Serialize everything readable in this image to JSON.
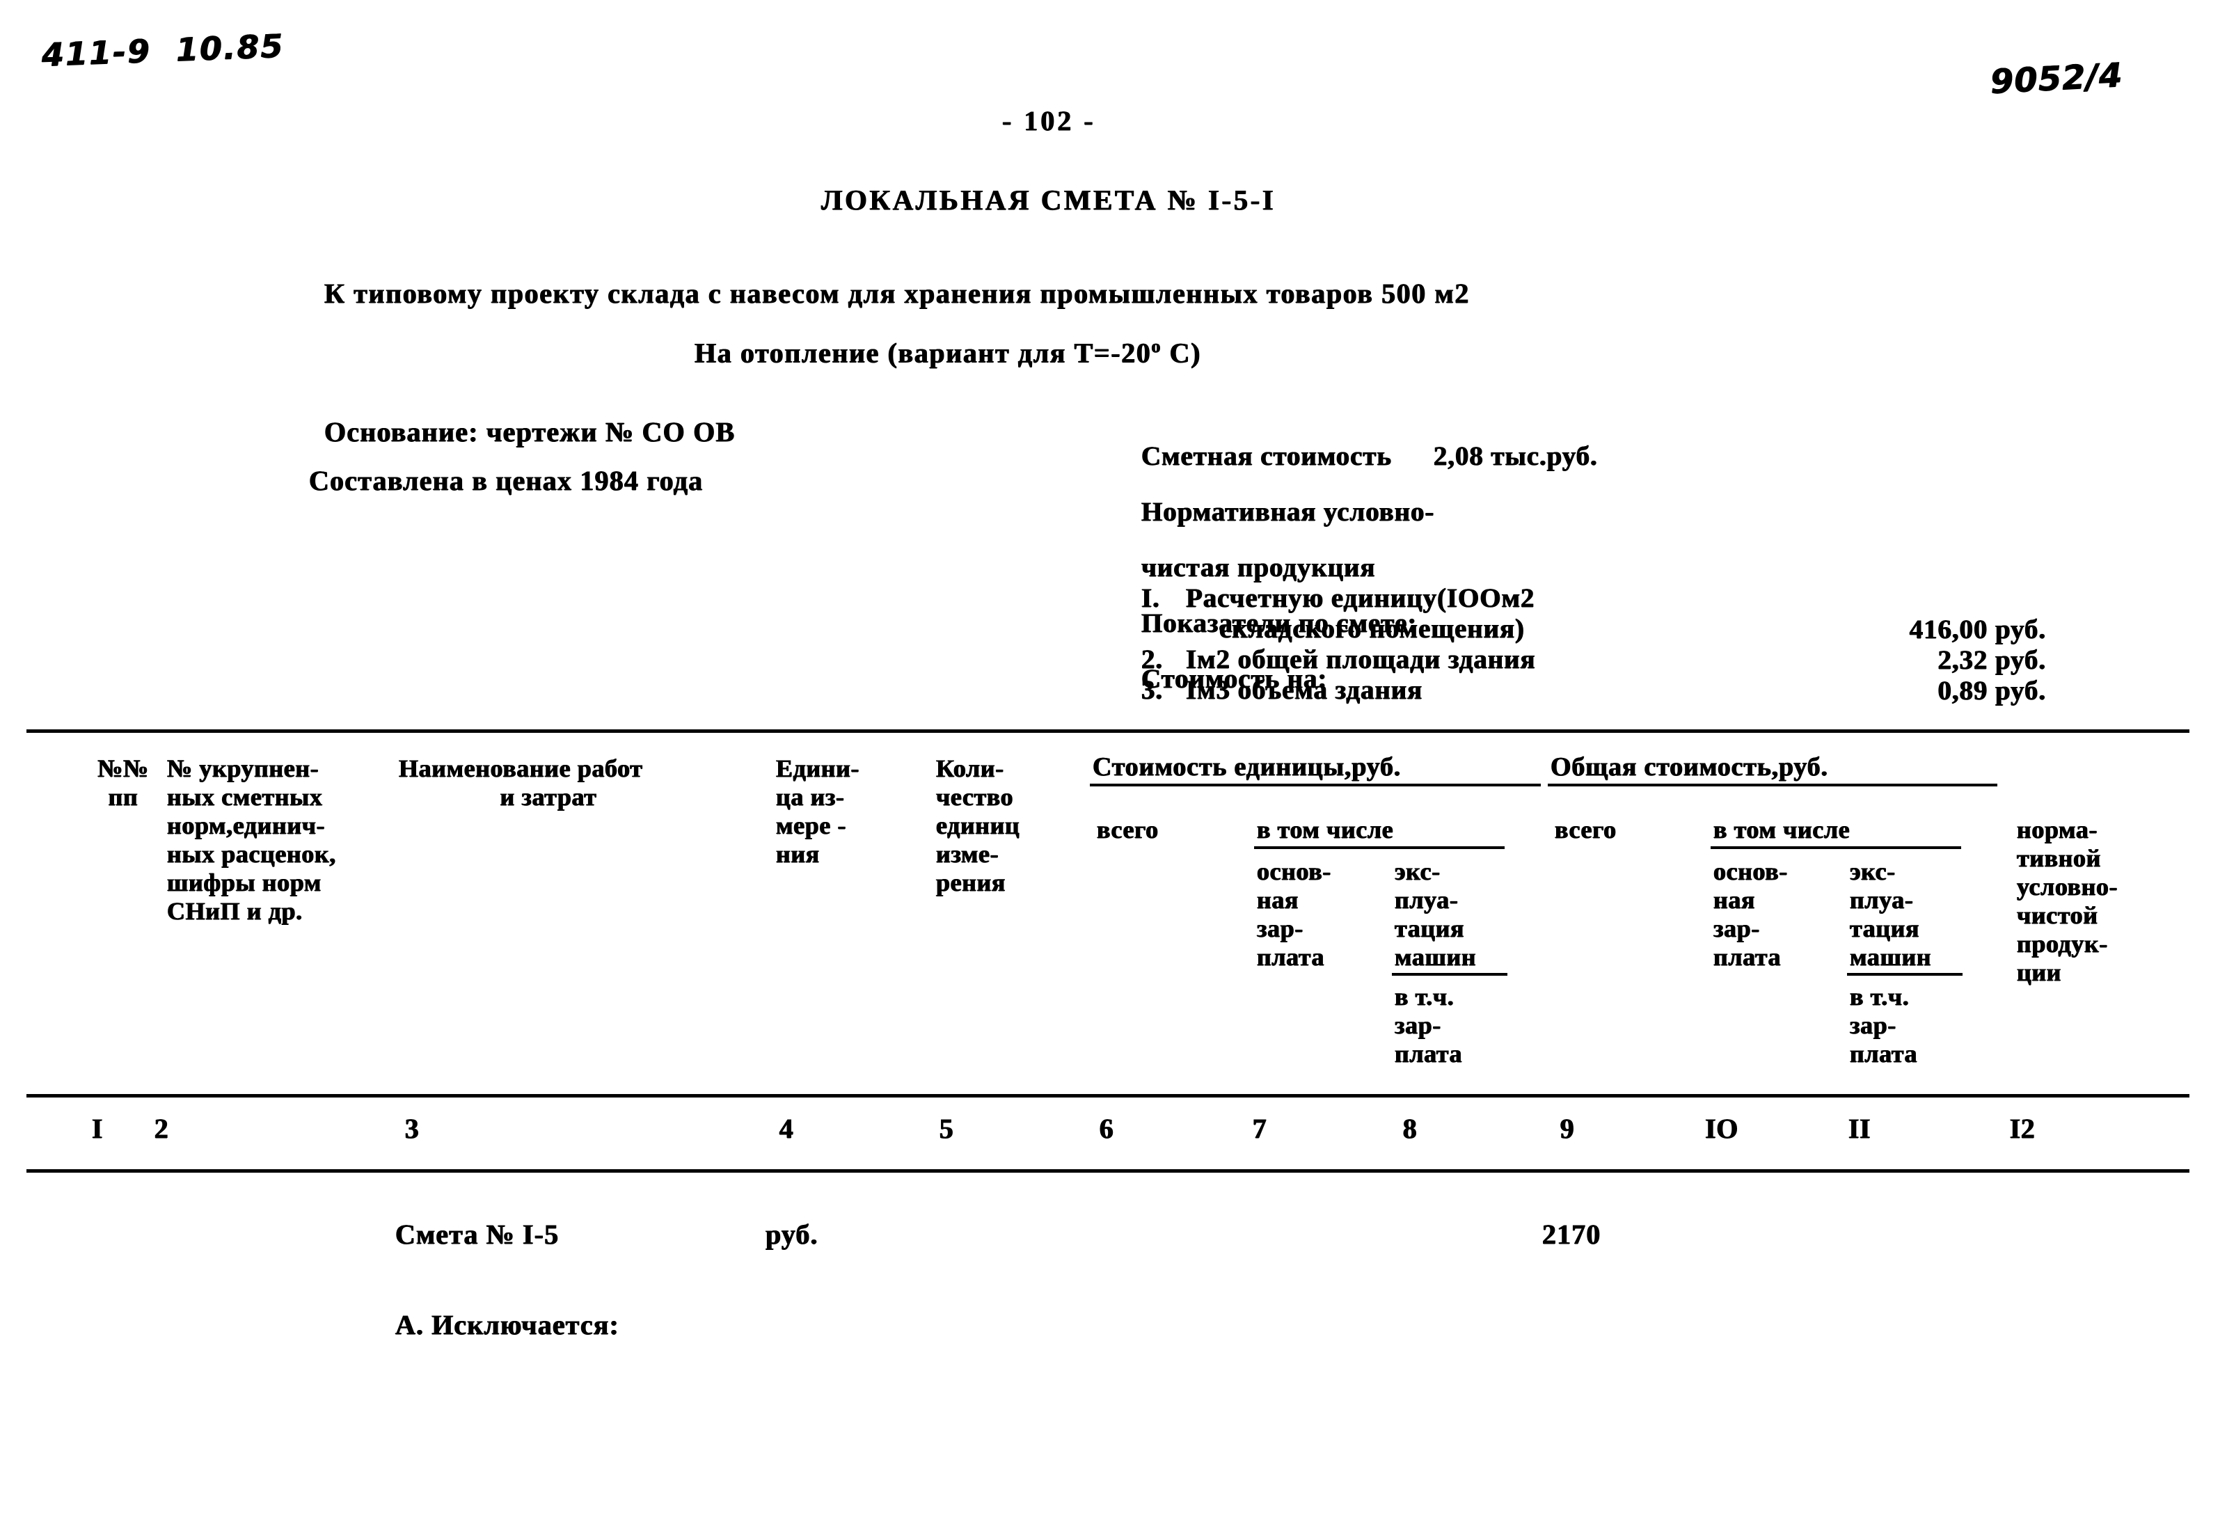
{
  "annotations": {
    "top_left": "411-9  10.85",
    "top_right": "9052/4"
  },
  "page_number": "- 102 -",
  "title": "ЛОКАЛЬНАЯ СМЕТА № I-5-I",
  "subtitle_1": "К типовому проекту склада с навесом для хранения промышленных товаров 500 м2",
  "subtitle_2": "На отопление (вариант для Т=-20",
  "subtitle_2_sup": "о",
  "subtitle_2_tail": " С)",
  "left_block": {
    "basis": "Основание: чертежи № СО ОВ",
    "prices": "Составлена в ценах 1984 года"
  },
  "summary": {
    "estimate_cost_label": "Сметная стоимость",
    "estimate_cost_value": "2,08 тыс.руб.",
    "normative_line_1": "Нормативная условно-",
    "normative_line_2": "чистая продукция",
    "indicators_label": "Показатели по смете:",
    "cost_for_label": "Стоимость на:",
    "items": [
      {
        "no": "I.",
        "text_line_1": "Расчетную единицу(IOOм2",
        "text_line_2": "складского помещения)",
        "value": "416,00 руб."
      },
      {
        "no": "2.",
        "text_line_1": "Iм2 общей площади здания",
        "text_line_2": "",
        "value": "2,32 руб."
      },
      {
        "no": "3.",
        "text_line_1": "Iм3 объема здания",
        "text_line_2": "",
        "value": "0,89 руб."
      }
    ]
  },
  "table": {
    "headers": {
      "col1": "№№\nпп",
      "col2": "№ укрупнен-\nных сметных\nнорм,единич-\nных расценок,\nшифры норм\nСНиП и др.",
      "col3_line1": "Наименование работ",
      "col3_line2": "и затрат",
      "col4": "Едини-\nца из-\nмере -\nния",
      "col5": "Коли-\nчество\nединиц\nизме-\nрения",
      "group_unit_cost": "Стоимость единицы,руб.",
      "group_total_cost": "Общая стоимость,руб.",
      "unit_total": "всего",
      "unit_among": "в том числе",
      "unit_wage": "основ-\nная\nзар-\nплата",
      "unit_machines": "экс-\nплуа-\nтация\nмашин",
      "unit_machines_sub": "в т.ч.\nзар-\nплата",
      "total_total": "всего",
      "total_among": "в том числе",
      "total_wage": "основ-\nная\nзар-\nплата",
      "total_machines": "экс-\nплуа-\nтация\nмашин",
      "total_machines_sub": "в т.ч.\nзар-\nплата",
      "col12": "норма-\nтивной\nусловно-\nчистой\nпродук-\nции"
    },
    "column_numbers": [
      "I",
      "2",
      "3",
      "4",
      "5",
      "6",
      "7",
      "8",
      "9",
      "IO",
      "II",
      "I2"
    ],
    "rows": [
      {
        "col2": "Смета № I-5",
        "col4": "руб.",
        "col9": "2170"
      },
      {
        "col2": "А. Исключается:"
      }
    ]
  }
}
